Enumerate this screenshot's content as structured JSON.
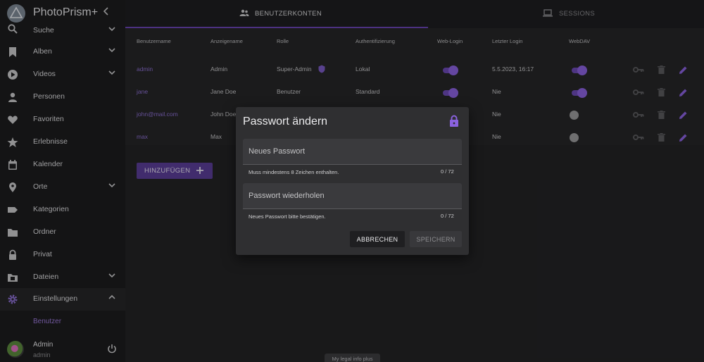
{
  "app": {
    "title": "PhotoPrism+"
  },
  "sidebar": {
    "items": [
      {
        "label": "Suche",
        "icon": "search-icon",
        "expandable": true
      },
      {
        "label": "Alben",
        "icon": "bookmark-icon",
        "expandable": true
      },
      {
        "label": "Videos",
        "icon": "play-circle-icon",
        "expandable": true
      },
      {
        "label": "Personen",
        "icon": "person-icon",
        "expandable": false
      },
      {
        "label": "Favoriten",
        "icon": "heart-icon",
        "expandable": false
      },
      {
        "label": "Erlebnisse",
        "icon": "star-icon",
        "expandable": false
      },
      {
        "label": "Kalender",
        "icon": "calendar-icon",
        "expandable": false
      },
      {
        "label": "Orte",
        "icon": "map-marker-icon",
        "expandable": true
      },
      {
        "label": "Kategorien",
        "icon": "label-icon",
        "expandable": false
      },
      {
        "label": "Ordner",
        "icon": "folder-icon",
        "expandable": false
      },
      {
        "label": "Privat",
        "icon": "lock-icon",
        "expandable": false
      },
      {
        "label": "Dateien",
        "icon": "film-folder-icon",
        "expandable": true
      },
      {
        "label": "Einstellungen",
        "icon": "gear-icon",
        "expandable": true,
        "expanded": true
      }
    ],
    "sub_item": "Benutzer",
    "user": {
      "name": "Admin",
      "role": "admin"
    }
  },
  "tabs": [
    {
      "label": "BENUTZERKONTEN",
      "icon": "users-icon",
      "active": true
    },
    {
      "label": "SESSIONS",
      "icon": "laptop-icon",
      "active": false
    }
  ],
  "table": {
    "headers": [
      "Benutzername",
      "Anzeigename",
      "Rolle",
      "Authentifizierung",
      "Web-Login",
      "Letzter Login",
      "WebDAV"
    ],
    "rows": [
      {
        "username": "admin",
        "display": "Admin",
        "role": "Super-Admin",
        "auth": "Lokal",
        "web_login": true,
        "last_login": "5.5.2023, 16:17",
        "webdav": true
      },
      {
        "username": "jane",
        "display": "Jane Doe",
        "role": "Benutzer",
        "auth": "Standard",
        "web_login": true,
        "last_login": "Nie",
        "webdav": true
      },
      {
        "username": "john@mail.com",
        "display": "John Doe",
        "role": "",
        "auth": "",
        "web_login": false,
        "last_login": "Nie",
        "webdav": false
      },
      {
        "username": "max",
        "display": "Max",
        "role": "",
        "auth": "",
        "web_login": false,
        "last_login": "Nie",
        "webdav": false
      }
    ]
  },
  "add_button": "HINZUFÜGEN",
  "footer": {
    "legal": "My legal info plus"
  },
  "dialog": {
    "title": "Passwort ändern",
    "new_password": {
      "placeholder": "Neues Passwort",
      "hint": "Muss mindestens 8 Zeichen enthalten.",
      "counter": "0 / 72"
    },
    "repeat_password": {
      "placeholder": "Passwort wiederholen",
      "hint": "Neues Passwort bitte bestätigen.",
      "counter": "0 / 72"
    },
    "cancel": "ABBRECHEN",
    "save": "SPEICHERN"
  },
  "colors": {
    "accent": "#6d4ab6",
    "link": "#8c6fd1",
    "background": "#232325",
    "sidebar": "#1c1c1e"
  }
}
